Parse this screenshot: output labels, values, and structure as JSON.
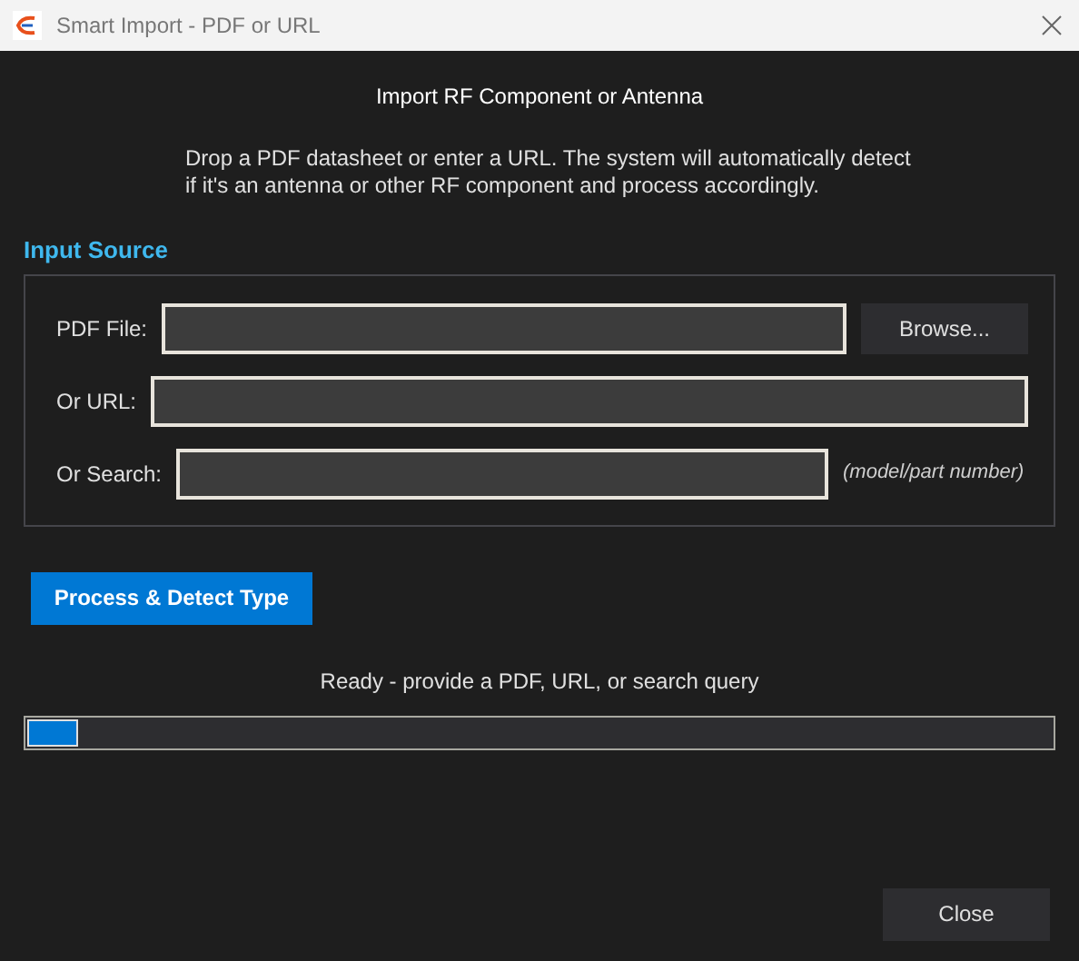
{
  "window": {
    "title": "Smart Import - PDF or URL"
  },
  "heading": "Import RF Component or Antenna",
  "description": "Drop a PDF datasheet or enter a URL. The system will automatically detect if it's an antenna or other RF component and process accordingly.",
  "input_source": {
    "title": "Input Source",
    "rows": [
      {
        "kind": "file",
        "label": "PDF File:",
        "button": "Browse..."
      },
      {
        "kind": "url",
        "label": "Or URL:"
      },
      {
        "kind": "search",
        "label": "Or Search:",
        "hint": "(model/part number)"
      }
    ]
  },
  "process_button": "Process & Detect Type",
  "status": "Ready - provide a PDF, URL, or search query",
  "progress": {
    "level": 0.05
  },
  "close_button": "Close"
}
